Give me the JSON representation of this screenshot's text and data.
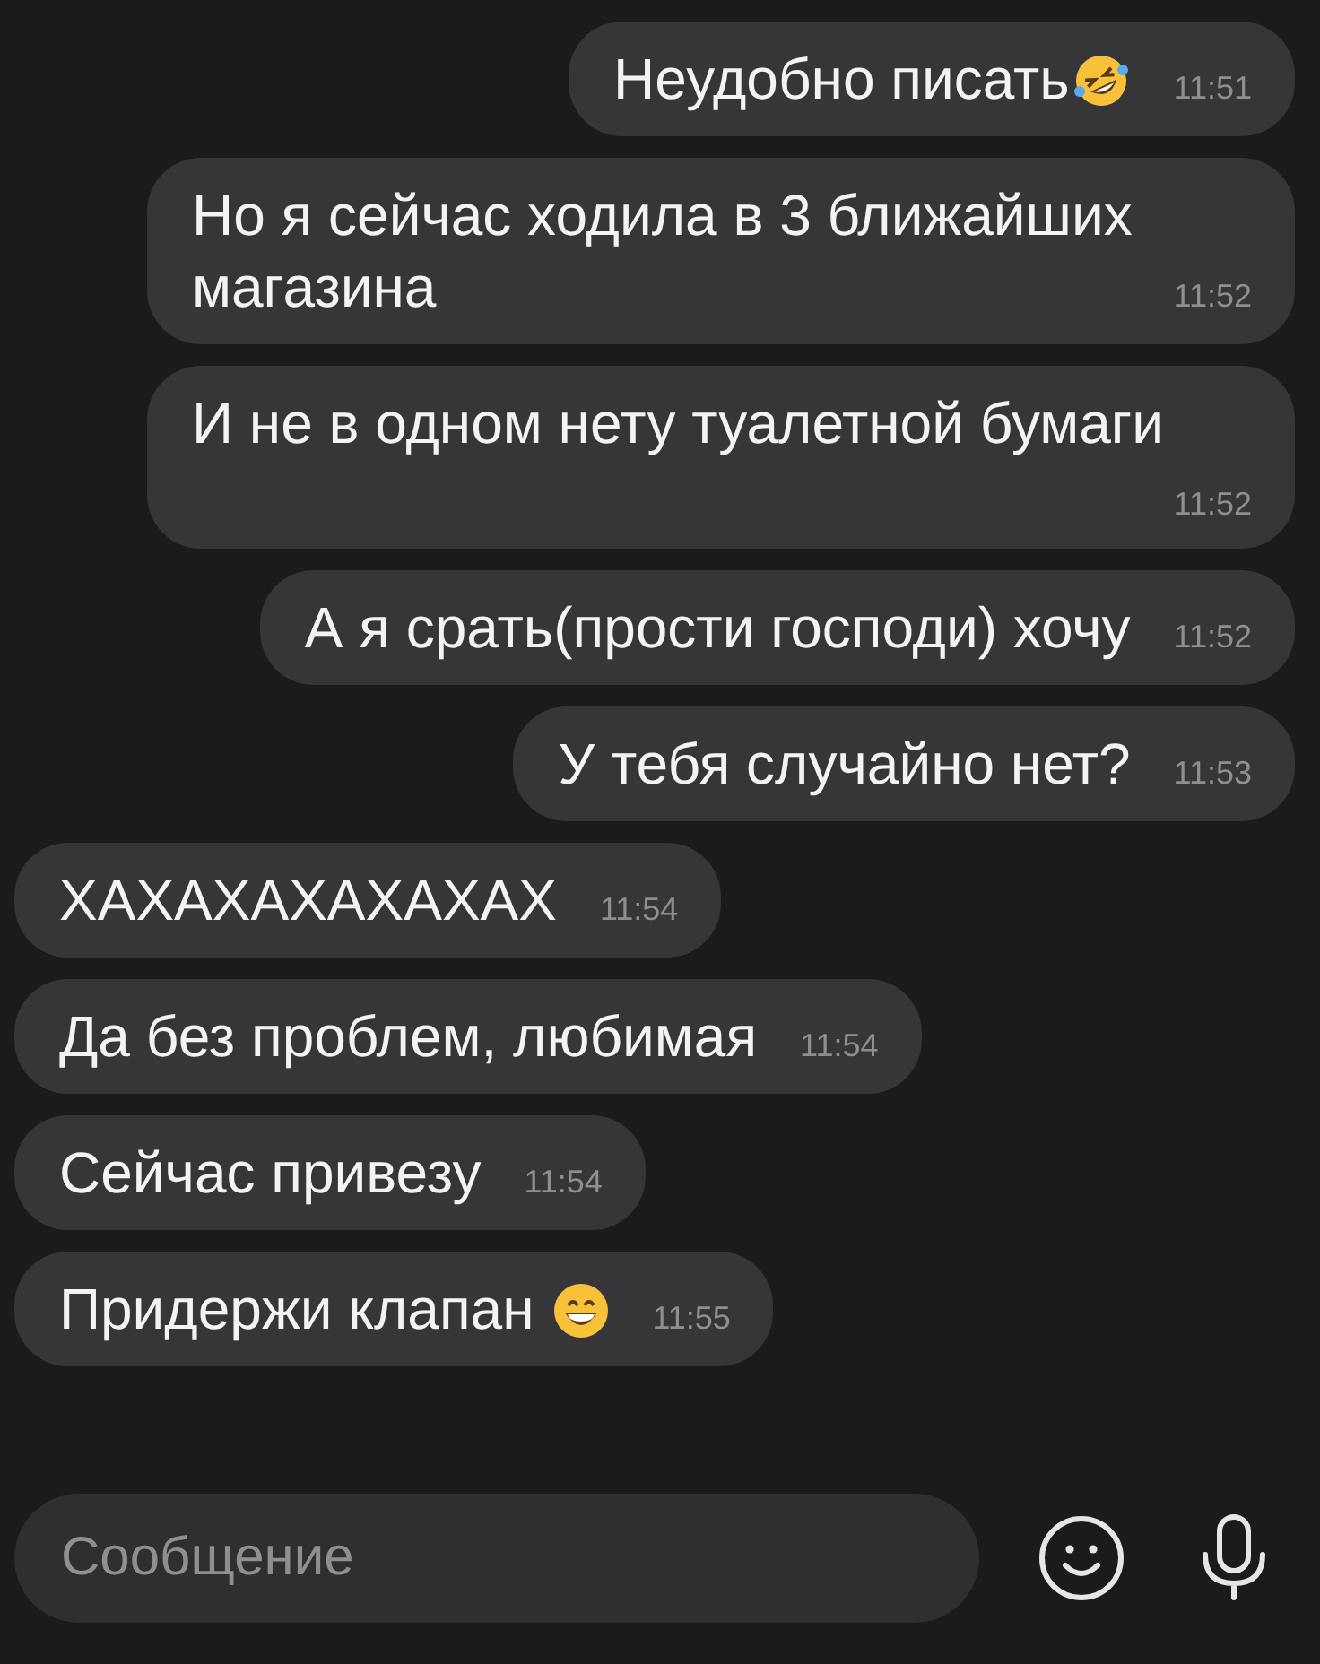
{
  "messages": [
    {
      "kind": "outgoing",
      "text": "Неудобно писать",
      "emoji": {
        "kind": "rofl"
      },
      "time": "11:51"
    },
    {
      "kind": "outgoing",
      "text": "Но я сейчас ходила в 3 ближайших магазина",
      "time": "11:52"
    },
    {
      "kind": "outgoing",
      "text": "И не в одном нету туалетной бумаги",
      "time": "11:52"
    },
    {
      "kind": "outgoing",
      "text": "А я срать(прости господи) хочу",
      "time": "11:52"
    },
    {
      "kind": "outgoing",
      "text": "У тебя случайно нет?",
      "time": "11:53"
    },
    {
      "kind": "incoming",
      "text": "ХАХАХАХАХАХАХ",
      "time": "11:54"
    },
    {
      "kind": "incoming",
      "text": "Да без проблем, любимая",
      "time": "11:54"
    },
    {
      "kind": "incoming",
      "text": "Сейчас привезу",
      "time": "11:54"
    },
    {
      "kind": "incoming",
      "text": "Придержи клапан",
      "emoji": {
        "kind": "grin"
      },
      "time": "11:55"
    }
  ],
  "composer": {
    "placeholder": "Сообщение"
  }
}
